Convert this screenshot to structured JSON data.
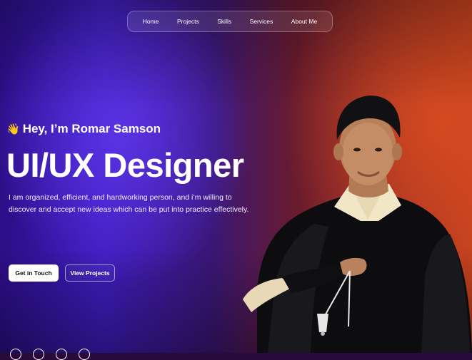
{
  "nav": {
    "items": [
      {
        "label": "Home"
      },
      {
        "label": "Projects"
      },
      {
        "label": "Skills"
      },
      {
        "label": "Services"
      },
      {
        "label": "About Me"
      }
    ]
  },
  "hero": {
    "wave_icon": "👋",
    "greeting": "Hey, I’m Romar Samson",
    "title": "UI/UX Designer",
    "description": "I am organized, efficient, and hardworking person, and  i’m willing to discover and accept new ideas which can be put into practice effectively.",
    "primary_button": "Get in Touch",
    "secondary_button": "View Projects"
  },
  "portrait": {
    "alt": "portrait-photo"
  },
  "colors": {
    "violet": "#3f1cc0",
    "orange": "#c3401f",
    "white": "#ffffff"
  }
}
